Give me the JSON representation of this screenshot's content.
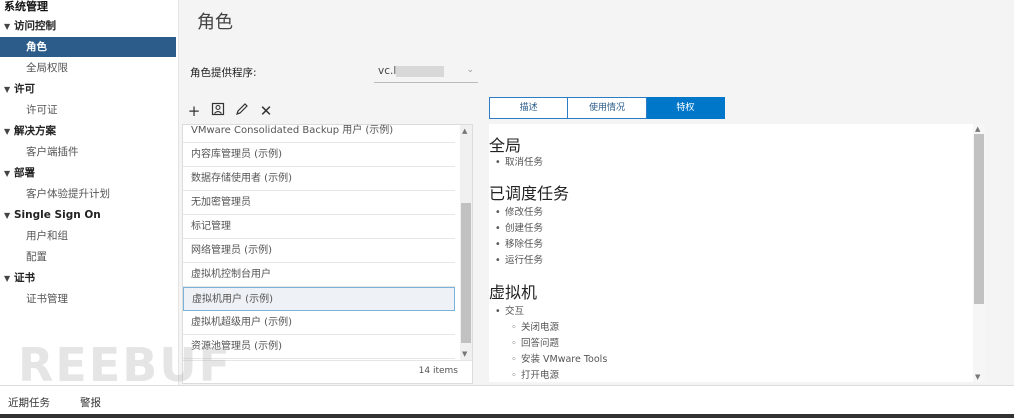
{
  "sidebar": {
    "title": "系统管理",
    "items": [
      {
        "label": "访问控制",
        "group": true
      },
      {
        "label": "角色",
        "selected": true
      },
      {
        "label": "全局权限"
      },
      {
        "label": "许可",
        "group": true
      },
      {
        "label": "许可证"
      },
      {
        "label": "解决方案",
        "group": true
      },
      {
        "label": "客户端插件"
      },
      {
        "label": "部署",
        "group": true
      },
      {
        "label": "客户体验提升计划"
      },
      {
        "label": "Single Sign On",
        "group": true
      },
      {
        "label": "用户和组"
      },
      {
        "label": "配置"
      },
      {
        "label": "证书",
        "group": true
      },
      {
        "label": "证书管理"
      }
    ]
  },
  "main": {
    "title": "角色",
    "provider_label": "角色提供程序:",
    "provider_value": "vc.l",
    "list": {
      "rows": [
        "VMware Consolidated Backup 用户 (示例)",
        "内容库管理员 (示例)",
        "数据存储使用者 (示例)",
        "无加密管理员",
        "标记管理",
        "网络管理员 (示例)",
        "虚拟机控制台用户",
        "虚拟机用户 (示例)",
        "虚拟机超级用户 (示例)",
        "资源池管理员 (示例)"
      ],
      "selected_index": 7,
      "count": "14 items"
    },
    "tabs": [
      "描述",
      "使用情况",
      "特权"
    ],
    "active_tab": 2,
    "detail": {
      "sections": [
        {
          "heading": "全局",
          "items": [
            "取消任务"
          ]
        },
        {
          "heading": "已调度任务",
          "items": [
            "修改任务",
            "创建任务",
            "移除任务",
            "运行任务"
          ]
        },
        {
          "heading": "虚拟机",
          "items": [
            "交互"
          ],
          "subitems": [
            "关闭电源",
            "回答问题",
            "安装 VMware Tools",
            "打开电源"
          ]
        }
      ]
    }
  },
  "bottom": {
    "tabs": [
      "近期任务",
      "警报"
    ]
  },
  "watermark": "REEBUF"
}
